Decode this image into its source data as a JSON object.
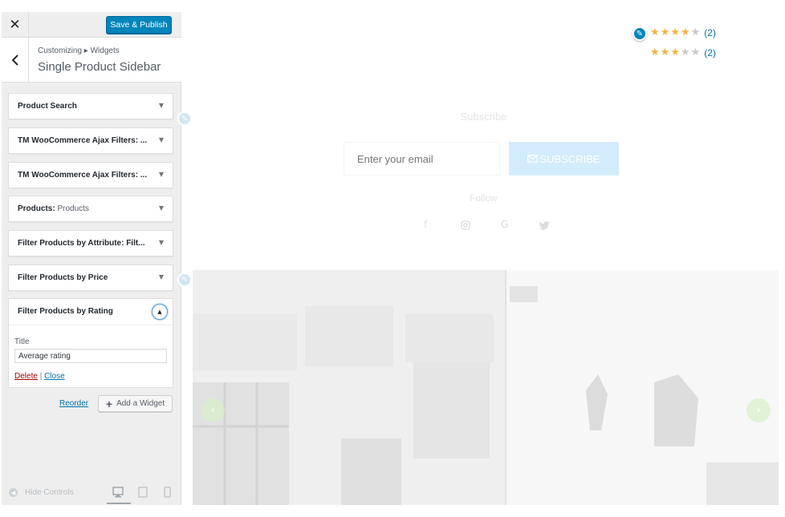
{
  "customizer": {
    "close_icon": "✕",
    "publish_label": "Save & Publish",
    "breadcrumb": "Customizing ▸ Widgets",
    "section_title": "Single Product Sidebar",
    "widgets": [
      {
        "title": "Product Search",
        "subtitle": ""
      },
      {
        "title": "TM WooCommerce Ajax Filters: ...",
        "subtitle": ""
      },
      {
        "title": "TM WooCommerce Ajax Filters: ...",
        "subtitle": ""
      },
      {
        "title": "Products:",
        "subtitle": " Products"
      },
      {
        "title": "Filter Products by Attribute: Filt...",
        "subtitle": ""
      },
      {
        "title": "Filter Products by Price",
        "subtitle": ""
      }
    ],
    "open_widget": {
      "title": "Filter Products by Rating",
      "field_label": "Title",
      "field_value": "Average rating",
      "delete_label": "Delete",
      "separator": "|",
      "close_label": "Close"
    },
    "reorder_label": "Reorder",
    "add_widget_label": "Add a Widget",
    "hide_controls_label": "Hide Controls",
    "accent_color": "#0085ba"
  },
  "preview": {
    "ratings": [
      {
        "filled": 4,
        "total": 5,
        "count": "(2)"
      },
      {
        "filled": 3,
        "total": 5,
        "count": "(2)"
      }
    ],
    "star_color": "#f5b342",
    "subscribe_title": "Subscribe",
    "email_placeholder": "Enter your email",
    "subscribe_button": "SUBSCRIBE",
    "follow_title": "Follow",
    "social_icons": [
      "facebook-icon",
      "instagram-icon",
      "google-icon",
      "twitter-icon"
    ]
  }
}
